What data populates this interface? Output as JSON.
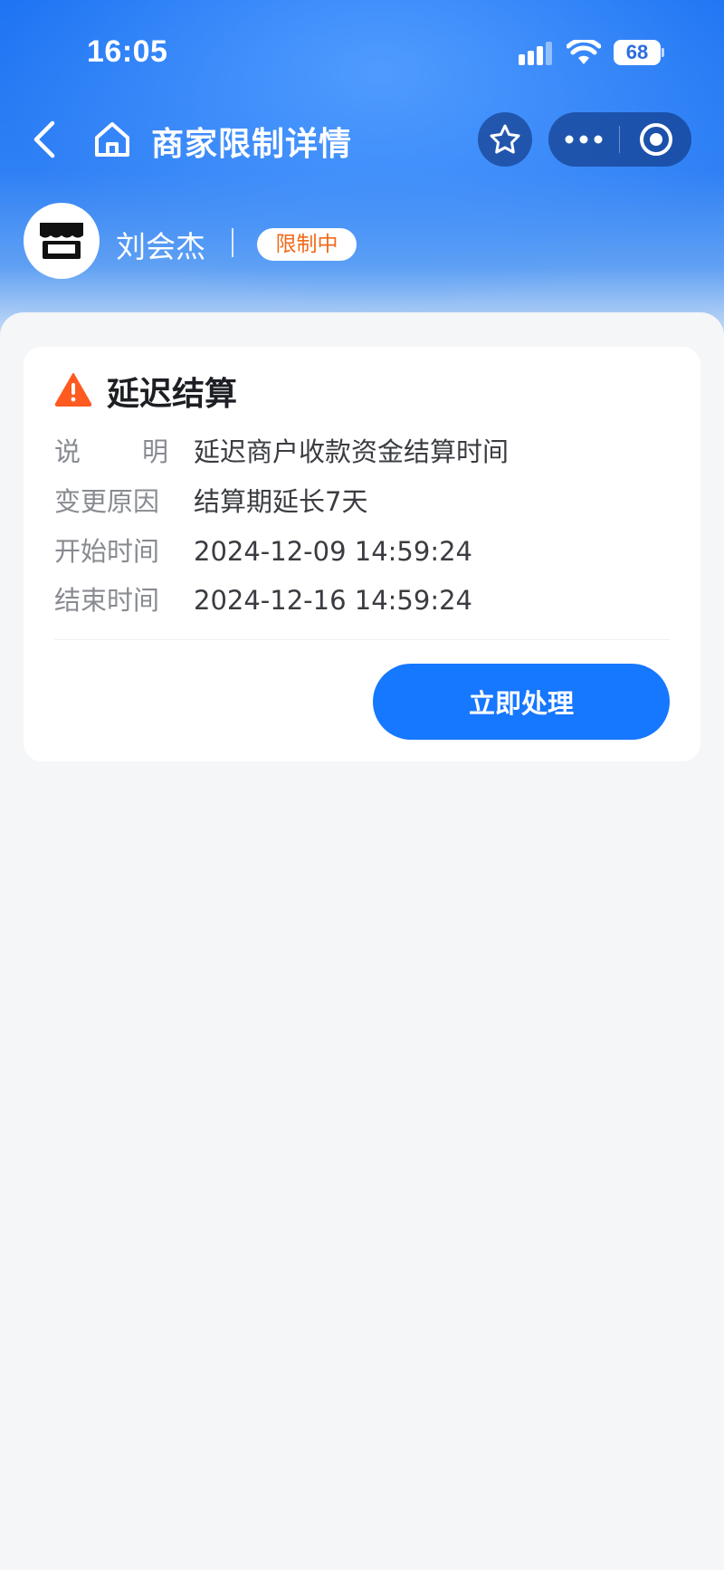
{
  "status_bar": {
    "time": "16:05",
    "battery": "68",
    "icons": [
      "signal-icon",
      "wifi-icon",
      "battery-icon"
    ]
  },
  "nav": {
    "title": "商家限制详情",
    "icons": [
      "back-icon",
      "home-icon",
      "star-icon",
      "more-icon",
      "close-circle-icon"
    ]
  },
  "merchant": {
    "name": "刘会杰",
    "status": "限制中",
    "avatar_icon": "store-icon"
  },
  "restriction": {
    "title": "延迟结算",
    "icon": "warning-icon",
    "rows": [
      {
        "label": [
          "说",
          "明"
        ],
        "value": "延迟商户收款资金结算时间"
      },
      {
        "label": [
          "变更原因"
        ],
        "value": "结算期延长7天"
      },
      {
        "label": [
          "开始时间"
        ],
        "value": "2024-12-09 14:59:24"
      },
      {
        "label": [
          "结束时间"
        ],
        "value": "2024-12-16 14:59:24"
      }
    ],
    "action_label": "立即处理"
  },
  "colors": {
    "primary": "#1677ff",
    "header": "#1f74f3",
    "badge_text": "#f06a1b",
    "warning": "#ff5a1f"
  }
}
